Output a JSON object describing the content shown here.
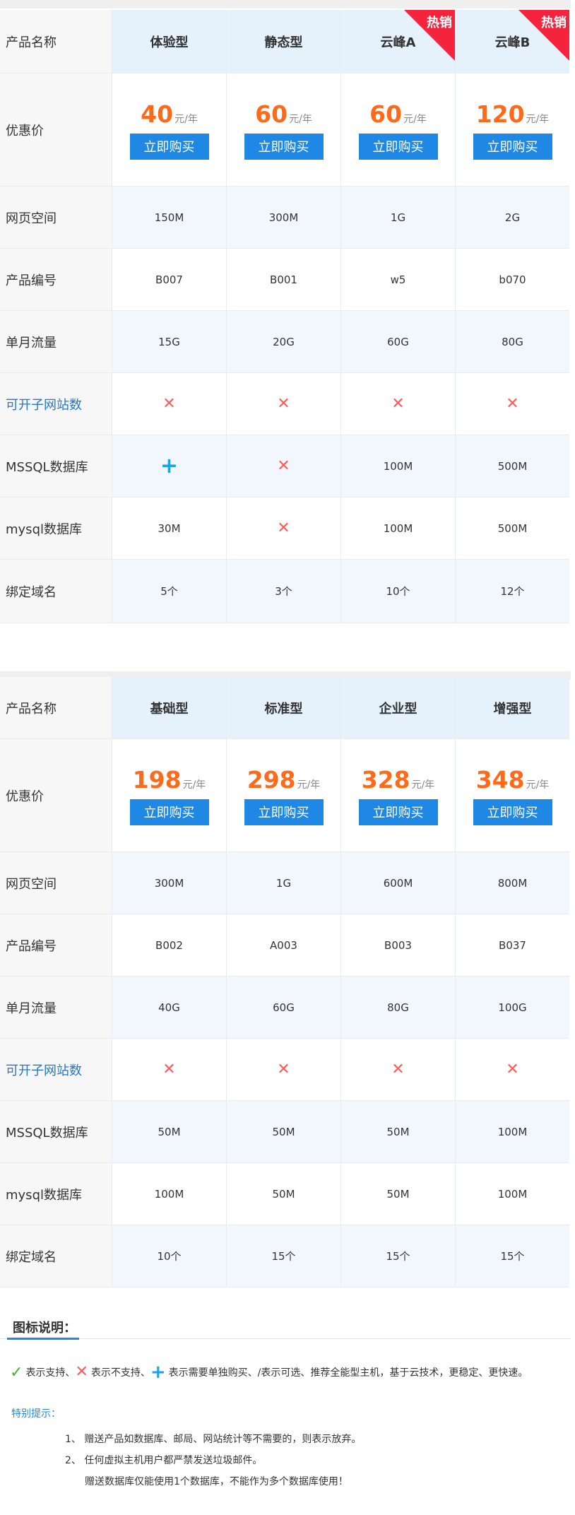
{
  "table1": {
    "row_labels": {
      "name": "产品名称",
      "price": "优惠价",
      "space": "网页空间",
      "code": "产品编号",
      "traffic": "单月流量",
      "subsites": "可开子网站数",
      "mssql": "MSSQL数据库",
      "mysql": "mysql数据库",
      "domains": "绑定域名"
    },
    "plans": [
      {
        "name": "体验型",
        "price": "40",
        "unit": "元/年",
        "buy": "立即购买",
        "hot": "",
        "space": "150M",
        "code": "B007",
        "traffic": "15G",
        "subsites": "✕",
        "mssql": "+",
        "mysql": "30M",
        "domains": "5个"
      },
      {
        "name": "静态型",
        "price": "60",
        "unit": "元/年",
        "buy": "立即购买",
        "hot": "",
        "space": "300M",
        "code": "B001",
        "traffic": "20G",
        "subsites": "✕",
        "mssql": "✕",
        "mysql": "✕",
        "domains": "3个"
      },
      {
        "name": "云峰A",
        "price": "60",
        "unit": "元/年",
        "buy": "立即购买",
        "hot": "热销",
        "space": "1G",
        "code": "w5",
        "traffic": "60G",
        "subsites": "✕",
        "mssql": "100M",
        "mysql": "100M",
        "domains": "10个"
      },
      {
        "name": "云峰B",
        "price": "120",
        "unit": "元/年",
        "buy": "立即购买",
        "hot": "热销",
        "space": "2G",
        "code": "b070",
        "traffic": "80G",
        "subsites": "✕",
        "mssql": "500M",
        "mysql": "500M",
        "domains": "12个"
      }
    ]
  },
  "table2": {
    "row_labels": {
      "name": "产品名称",
      "price": "优惠价",
      "space": "网页空间",
      "code": "产品编号",
      "traffic": "单月流量",
      "subsites": "可开子网站数",
      "mssql": "MSSQL数据库",
      "mysql": "mysql数据库",
      "domains": "绑定域名"
    },
    "plans": [
      {
        "name": "基础型",
        "price": "198",
        "unit": "元/年",
        "buy": "立即购买",
        "space": "300M",
        "code": "B002",
        "traffic": "40G",
        "subsites": "✕",
        "mssql": "50M",
        "mysql": "100M",
        "domains": "10个"
      },
      {
        "name": "标准型",
        "price": "298",
        "unit": "元/年",
        "buy": "立即购买",
        "space": "1G",
        "code": "A003",
        "traffic": "60G",
        "subsites": "✕",
        "mssql": "50M",
        "mysql": "50M",
        "domains": "15个"
      },
      {
        "name": "企业型",
        "price": "328",
        "unit": "元/年",
        "buy": "立即购买",
        "space": "600M",
        "code": "B003",
        "traffic": "80G",
        "subsites": "✕",
        "mssql": "50M",
        "mysql": "50M",
        "domains": "15个"
      },
      {
        "name": "增强型",
        "price": "348",
        "unit": "元/年",
        "buy": "立即购买",
        "space": "800M",
        "code": "B037",
        "traffic": "100G",
        "subsites": "✕",
        "mssql": "100M",
        "mysql": "100M",
        "domains": "15个"
      }
    ]
  },
  "legend": {
    "title": "图标说明：",
    "tick_icon": "✓",
    "cross_icon": "✕",
    "plus_icon": "+",
    "text_support": "表示支持、",
    "text_nosupport": "表示不支持、",
    "text_rest": "表示需要单独购买、/表示可选、推荐全能型主机，基于云技术，更稳定、更快速。",
    "special_title": "特别提示：",
    "note1": "1、 赠送产品如数据库、邮局、网站统计等不需要的，则表示放弃。",
    "note2": "2、 任何虚拟主机用户都严禁发送垃圾邮件。",
    "note3": "赠送数据库仅能使用1个数据库，不能作为多个数据库使用！"
  },
  "colors": {
    "accent": "#1f88e5",
    "price": "#ff6a1a",
    "hot": "#f5233c",
    "cross": "#ff5a5a",
    "plus": "#1fa1e6",
    "tick": "#4caf34"
  }
}
